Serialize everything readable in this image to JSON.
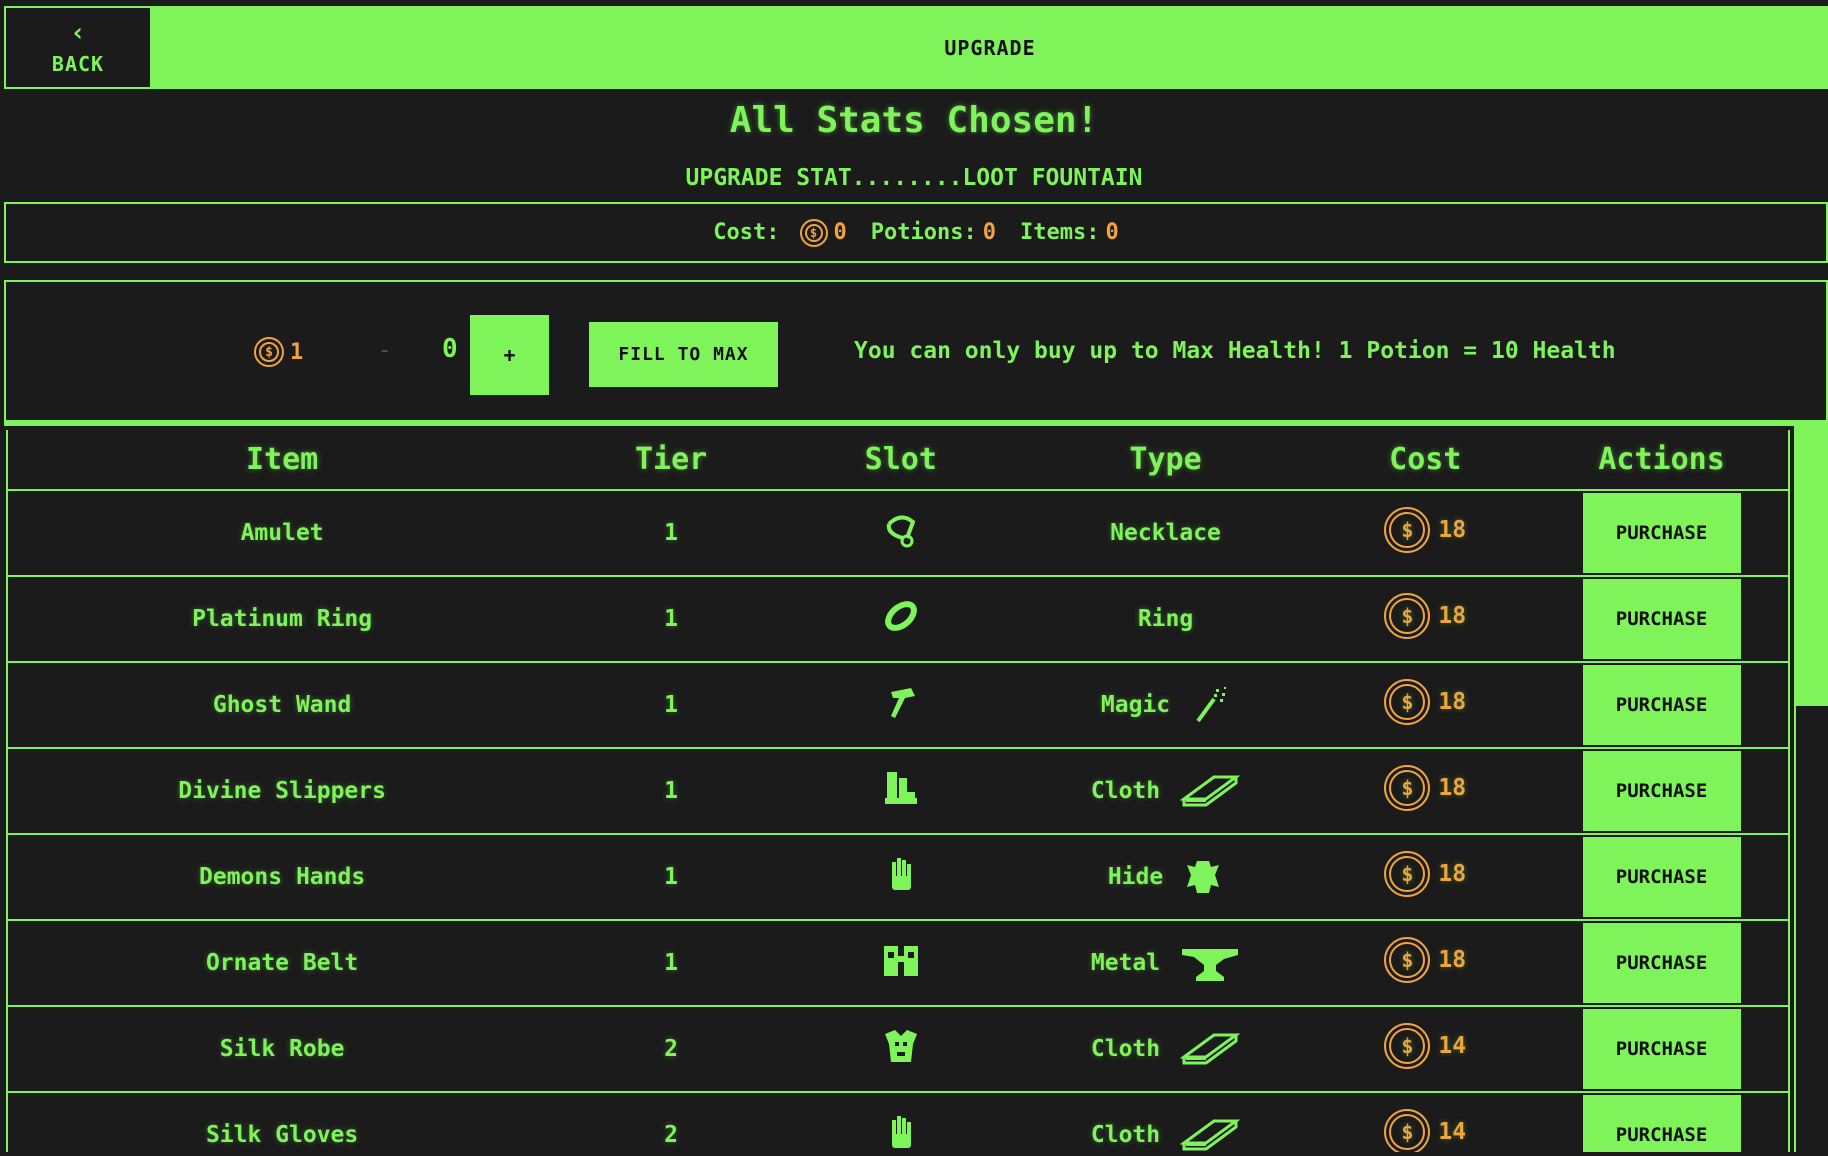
{
  "header": {
    "back_label": "BACK",
    "back_icon": "chevron-left-icon",
    "title": "UPGRADE"
  },
  "heading": "All Stats Chosen!",
  "subheading": "UPGRADE STAT........LOOT FOUNTAIN",
  "summary": {
    "cost_label": "Cost:",
    "cost_value": "0",
    "potions_label": "Potions:",
    "potions_value": "0",
    "items_label": "Items:",
    "items_value": "0"
  },
  "potion": {
    "price": "1",
    "minus_label": "-",
    "quantity": "0",
    "plus_label": "+",
    "fill_label": "FILL TO MAX",
    "message": "You can only buy up to Max Health! 1 Potion = 10 Health"
  },
  "table": {
    "headers": [
      "Item",
      "Tier",
      "Slot",
      "Type",
      "Cost",
      "Actions"
    ],
    "purchase_label": "PURCHASE",
    "rows": [
      {
        "item": "Amulet",
        "tier": "1",
        "slot_icon": "necklace-icon",
        "type": "Necklace",
        "type_icon": "",
        "cost": "18"
      },
      {
        "item": "Platinum Ring",
        "tier": "1",
        "slot_icon": "ring-icon",
        "type": "Ring",
        "type_icon": "",
        "cost": "18"
      },
      {
        "item": "Ghost Wand",
        "tier": "1",
        "slot_icon": "weapon-icon",
        "type": "Magic",
        "type_icon": "magic-wand-icon",
        "cost": "18"
      },
      {
        "item": "Divine Slippers",
        "tier": "1",
        "slot_icon": "boots-icon",
        "type": "Cloth",
        "type_icon": "cloth-icon",
        "cost": "18"
      },
      {
        "item": "Demons Hands",
        "tier": "1",
        "slot_icon": "gloves-icon",
        "type": "Hide",
        "type_icon": "hide-icon",
        "cost": "18"
      },
      {
        "item": "Ornate Belt",
        "tier": "1",
        "slot_icon": "belt-icon",
        "type": "Metal",
        "type_icon": "anvil-icon",
        "cost": "18"
      },
      {
        "item": "Silk Robe",
        "tier": "2",
        "slot_icon": "chest-armor-icon",
        "type": "Cloth",
        "type_icon": "cloth-icon",
        "cost": "14"
      },
      {
        "item": "Silk Gloves",
        "tier": "2",
        "slot_icon": "gloves-icon",
        "type": "Cloth",
        "type_icon": "cloth-icon",
        "cost": "14"
      }
    ]
  },
  "colors": {
    "accent": "#7ef35a",
    "background": "#1b1b1b",
    "gold": "#f0a43c"
  }
}
